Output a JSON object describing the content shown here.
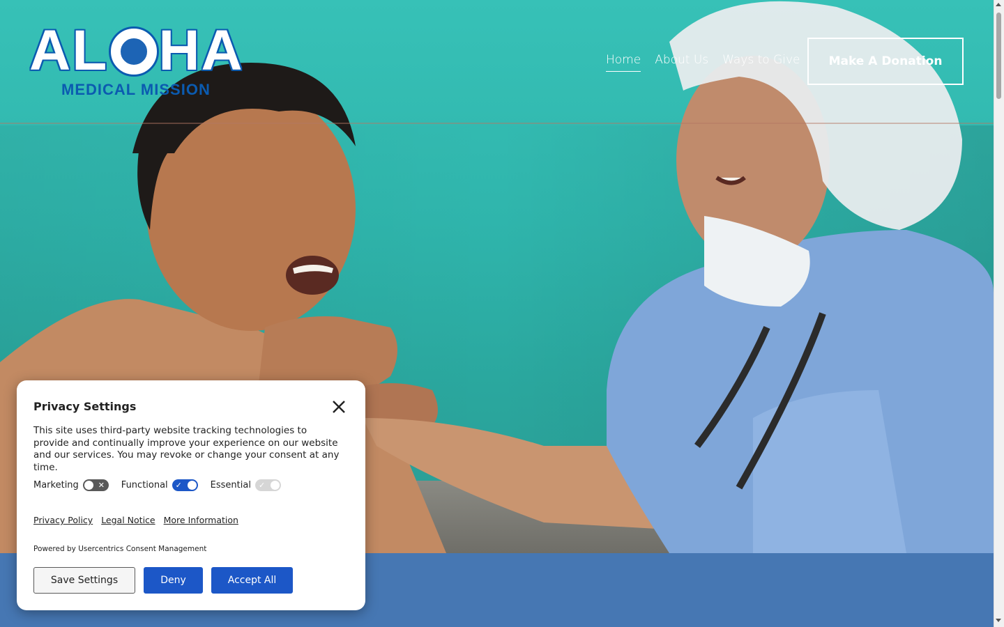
{
  "brand": {
    "logo_word_left": "AL",
    "logo_word_right": "HA",
    "logo_subtitle": "MEDICAL MISSION",
    "logo_color": "#0b5bb0"
  },
  "nav": {
    "items": [
      {
        "label": "Home",
        "active": true
      },
      {
        "label": "About Us",
        "active": false
      },
      {
        "label": "Ways to Give",
        "active": false
      }
    ],
    "cta_label": "Make A Donation"
  },
  "hero": {
    "image": "doctor-and-patient-photo",
    "band_color": "#4677b3"
  },
  "privacy": {
    "title": "Privacy Settings",
    "description": "This site uses third-party website tracking technologies to provide and continually improve your experience on our website and our services. You may revoke or change your consent at any time.",
    "toggles": [
      {
        "label": "Marketing",
        "state": "off"
      },
      {
        "label": "Functional",
        "state": "on"
      },
      {
        "label": "Essential",
        "state": "disabled-on"
      }
    ],
    "links": [
      "Privacy Policy",
      "Legal Notice",
      "More Information"
    ],
    "powered_by": "Powered by Usercentrics Consent Management",
    "buttons": {
      "save": "Save Settings",
      "deny": "Deny",
      "accept": "Accept All"
    },
    "accent_color": "#1c57c7"
  }
}
